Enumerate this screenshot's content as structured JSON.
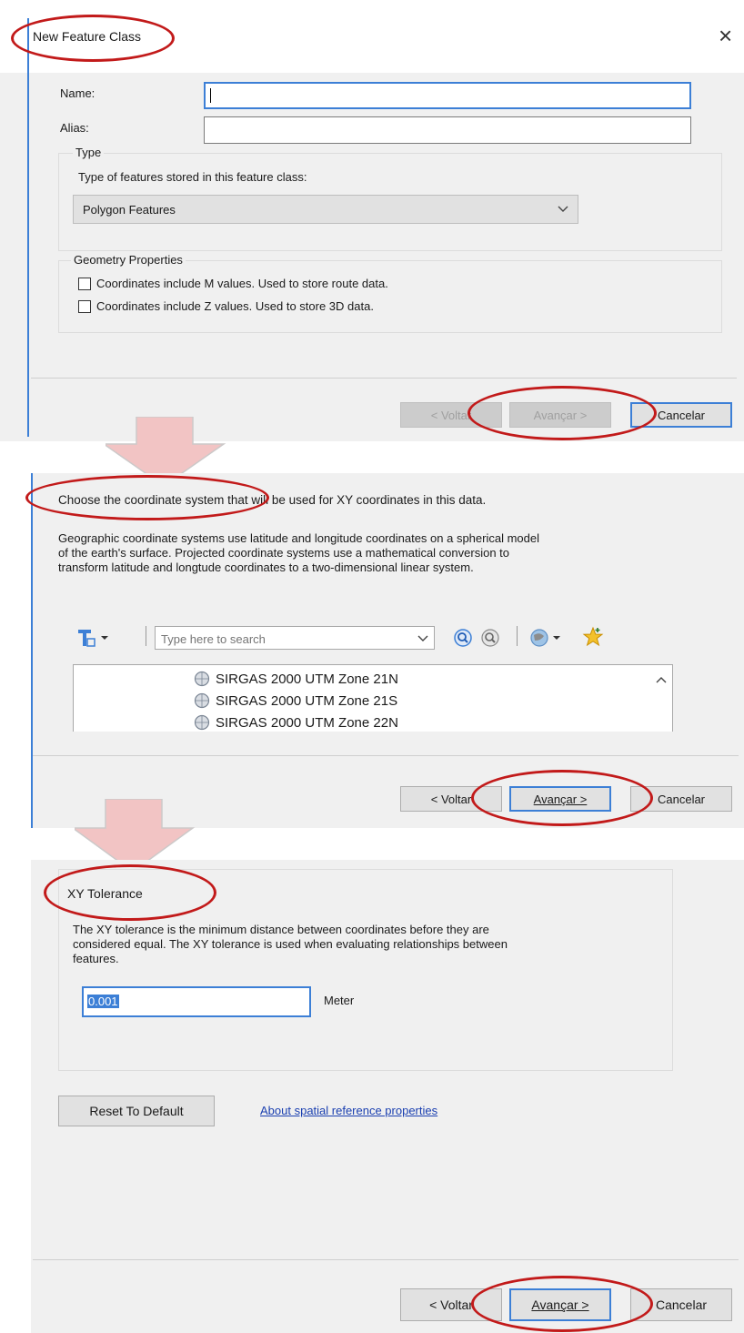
{
  "colors": {
    "annotation": "#c21a1a",
    "dialog_bg": "#f0f0f0",
    "accent": "#3c7fd6",
    "link": "#1a3fb0",
    "arrow": "#f2c4c4"
  },
  "dialog1": {
    "title": "New Feature Class",
    "close_glyph": "×",
    "name_label": "Name:",
    "name_value": "",
    "alias_label": "Alias:",
    "alias_value": "",
    "type_group": "Type",
    "type_desc": "Type of features stored in this feature class:",
    "type_selected": "Polygon Features",
    "geometry_group": "Geometry Properties",
    "checkbox_m": "Coordinates include M values. Used to store route data.",
    "checkbox_z": "Coordinates include Z values. Used to store 3D data.",
    "back_button": "< Voltar",
    "next_button": "Avançar >",
    "cancel_button": "Cancelar"
  },
  "dialog2": {
    "heading": "Choose the coordinate system that will be used for XY coordinates in this data.",
    "desc_line1": "Geographic coordinate systems use latitude and longitude coordinates on a spherical model",
    "desc_line2": "of the earth's surface. Projected coordinate systems use a mathematical conversion to",
    "desc_line3": "transform latitude and longtude coordinates to a two-dimensional linear system.",
    "search_placeholder": "Type here to search",
    "list_items": [
      "SIRGAS 2000 UTM Zone 21N",
      "SIRGAS 2000 UTM Zone 21S",
      "SIRGAS 2000 UTM Zone 22N"
    ],
    "back_button": "< Voltar",
    "next_button": "Avançar >",
    "cancel_button": "Cancelar"
  },
  "dialog3": {
    "group_title": "XY Tolerance",
    "desc_line1": "The XY tolerance is the minimum distance between coordinates before they are",
    "desc_line2": "considered equal. The XY tolerance is used when evaluating relationships between",
    "desc_line3": "features.",
    "tolerance_value": "0.001",
    "unit": "Meter",
    "reset_button": "Reset To Default",
    "about_link": "About spatial reference properties",
    "back_button": "< Voltar",
    "next_button": "Avançar >",
    "cancel_button": "Cancelar"
  }
}
